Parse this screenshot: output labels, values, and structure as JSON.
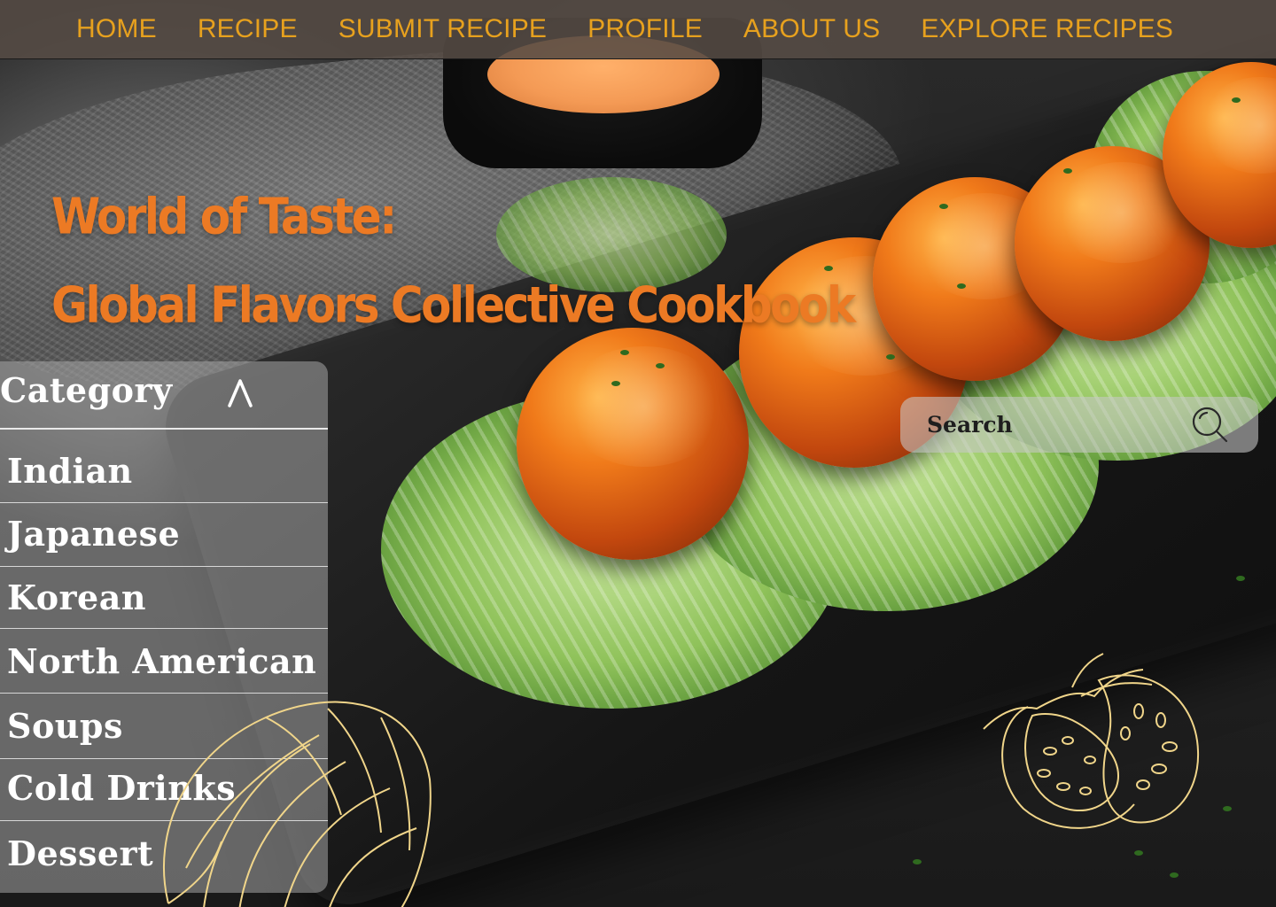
{
  "nav": {
    "items": [
      {
        "label": "HOME"
      },
      {
        "label": "RECIPE"
      },
      {
        "label": "SUBMIT RECIPE"
      },
      {
        "label": "PROFILE"
      },
      {
        "label": "ABOUT US"
      },
      {
        "label": "EXPLORE RECIPES"
      }
    ]
  },
  "hero": {
    "line1": "World of Taste:",
    "line2": "Global Flavors Collective Cookbook"
  },
  "category": {
    "title": "Category",
    "items": [
      {
        "label": "Indian"
      },
      {
        "label": "Japanese"
      },
      {
        "label": "Korean"
      },
      {
        "label": "North American"
      },
      {
        "label": "Soups"
      },
      {
        "label": "Cold Drinks"
      },
      {
        "label": "Dessert"
      }
    ]
  },
  "search": {
    "placeholder": "Search"
  },
  "colors": {
    "nav_text": "#e7a11e",
    "title": "#ec7a24",
    "panel_text": "#ffffff",
    "line_art": "#f0d58a"
  },
  "icons": {
    "chevron": "chevron-up-icon",
    "search": "search-icon",
    "tomato": "tomato-outline-icon",
    "leaf": "monstera-leaf-icon"
  }
}
